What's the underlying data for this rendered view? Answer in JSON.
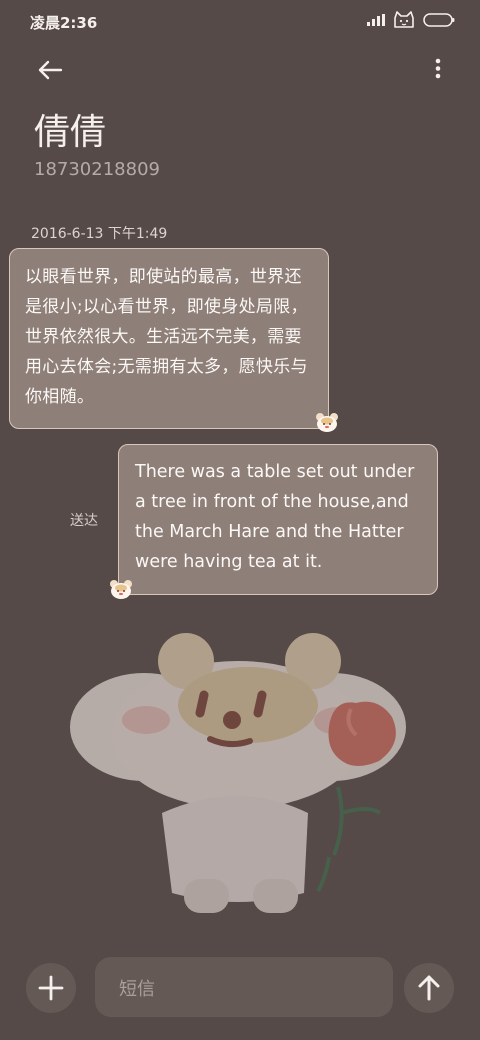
{
  "status_bar": {
    "time": "凌晨2:36",
    "signal_icon": "signal-bars",
    "cat_icon": "cat-face",
    "battery_icon": "battery"
  },
  "header": {
    "back_icon": "arrow-left",
    "menu_icon": "more-vertical",
    "contact_name": "倩倩",
    "contact_number": "18730218809"
  },
  "conversation": {
    "timestamp": "2016-6-13 下午1:49",
    "received_message": {
      "text": "以眼看世界，即使站的最高，世界还是很小;以心看世界，即使身处局限，世界依然很大。生活远不完美，需要用心去体会;无需拥有太多，愿快乐与你相随。"
    },
    "sent_message": {
      "text": "There was a table set out under a tree in front of the house,and the March Hare and the Hatter were having tea at it.",
      "status": "送达"
    },
    "sticker_icon": "bear-holding-tulip"
  },
  "composer": {
    "placeholder": "短信",
    "add_icon": "plus",
    "send_icon": "arrow-up"
  },
  "colors": {
    "background": "#554a47",
    "bubble": "#8f7f79",
    "bubble_border": "#d8c7bd",
    "control": "#655955"
  }
}
